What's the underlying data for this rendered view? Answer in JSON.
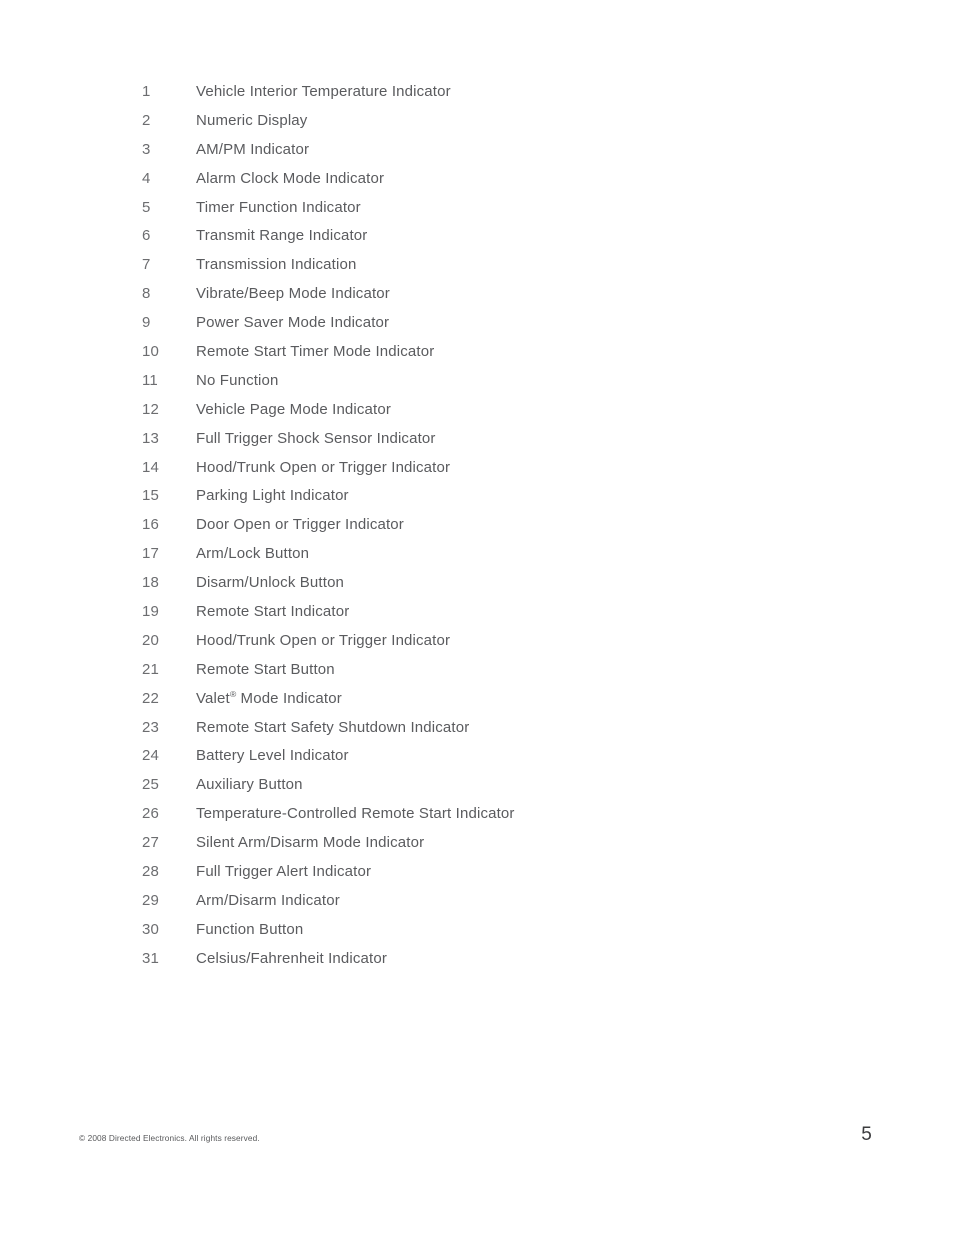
{
  "document": {
    "page_number": "5",
    "copyright": "© 2008 Directed Electronics. All rights reserved."
  },
  "feature_list": {
    "items": [
      {
        "number": "1",
        "label": "Vehicle Interior Temperature Indicator"
      },
      {
        "number": "2",
        "label": "Numeric Display"
      },
      {
        "number": "3",
        "label": "AM/PM Indicator"
      },
      {
        "number": "4",
        "label": "Alarm Clock Mode Indicator"
      },
      {
        "number": "5",
        "label": "Timer Function Indicator"
      },
      {
        "number": "6",
        "label": "Transmit Range Indicator"
      },
      {
        "number": "7",
        "label": "Transmission Indication"
      },
      {
        "number": "8",
        "label": "Vibrate/Beep Mode Indicator"
      },
      {
        "number": "9",
        "label": "Power Saver Mode Indicator"
      },
      {
        "number": "10",
        "label": "Remote Start Timer Mode Indicator"
      },
      {
        "number": "11",
        "label": "No Function"
      },
      {
        "number": "12",
        "label": "Vehicle Page Mode Indicator"
      },
      {
        "number": "13",
        "label": "Full Trigger Shock Sensor Indicator"
      },
      {
        "number": "14",
        "label": "Hood/Trunk Open or Trigger Indicator"
      },
      {
        "number": "15",
        "label": "Parking Light Indicator"
      },
      {
        "number": "16",
        "label": "Door Open or Trigger Indicator"
      },
      {
        "number": "17",
        "label": "Arm/Lock Button"
      },
      {
        "number": "18",
        "label": "Disarm/Unlock Button"
      },
      {
        "number": "19",
        "label": "Remote Start Indicator"
      },
      {
        "number": "20",
        "label": "Hood/Trunk Open or Trigger Indicator"
      },
      {
        "number": "21",
        "label": "Remote Start Button"
      },
      {
        "number": "22",
        "label": "Valet",
        "superscript": "®",
        "label_suffix": " Mode Indicator"
      },
      {
        "number": "23",
        "label": "Remote Start Safety Shutdown Indicator"
      },
      {
        "number": "24",
        "label": "Battery Level Indicator"
      },
      {
        "number": "25",
        "label": "Auxiliary Button"
      },
      {
        "number": "26",
        "label": "Temperature-Controlled Remote Start Indicator"
      },
      {
        "number": "27",
        "label": "Silent Arm/Disarm Mode Indicator"
      },
      {
        "number": "28",
        "label": "Full Trigger Alert Indicator"
      },
      {
        "number": "29",
        "label": "Arm/Disarm Indicator"
      },
      {
        "number": "30",
        "label": "Function Button"
      },
      {
        "number": "31",
        "label": "Celsius/Fahrenheit Indicator"
      }
    ]
  },
  "colors": {
    "page_background": "#ffffff",
    "body_text": "#5a5b5e",
    "number_text": "#6c6d70",
    "footer_text": "#58595b",
    "page_number_text": "#3b3c3e"
  }
}
